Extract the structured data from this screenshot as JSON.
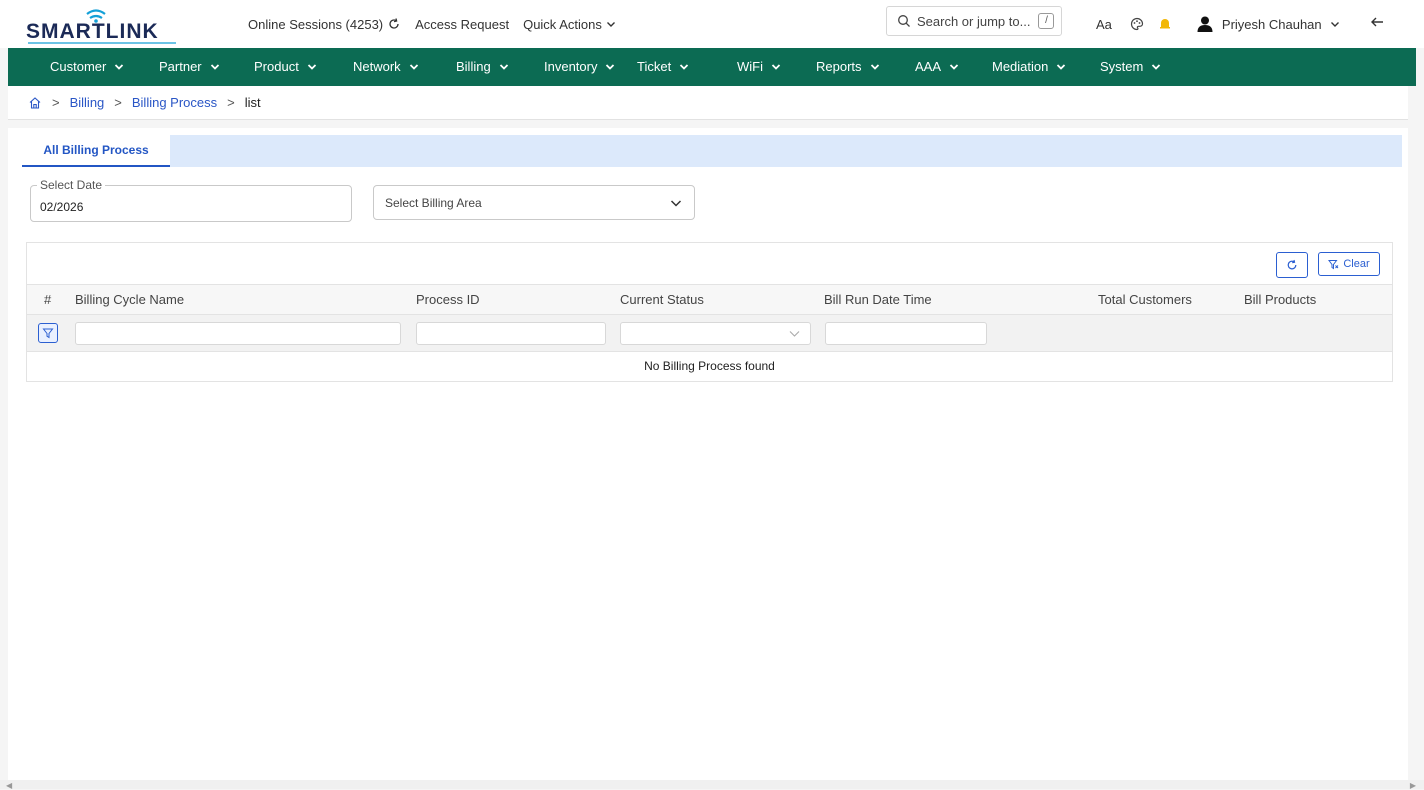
{
  "brand": {
    "logo_text": "SMARTLINK",
    "logo_color": "#1b2a57",
    "accent": "#0c6b53"
  },
  "top": {
    "online_sessions": "Online Sessions (4253)",
    "access_request": "Access Request",
    "quick_actions": "Quick Actions",
    "search_placeholder": "Search or jump to...",
    "search_shortcut": "/",
    "font_size_label": "Aa",
    "user_name": "Priyesh Chauhan",
    "icons": [
      "refresh-icon",
      "chevron-down-icon",
      "search-icon",
      "palette-icon",
      "bell-icon",
      "user-icon",
      "back-arrow-icon"
    ]
  },
  "nav": {
    "items": [
      {
        "label": "Customer"
      },
      {
        "label": "Partner"
      },
      {
        "label": "Product"
      },
      {
        "label": "Network"
      },
      {
        "label": "Billing"
      },
      {
        "label": "Inventory"
      },
      {
        "label": "Ticket"
      },
      {
        "label": "WiFi"
      },
      {
        "label": "Reports"
      },
      {
        "label": "AAA"
      },
      {
        "label": "Mediation"
      },
      {
        "label": "System"
      }
    ]
  },
  "breadcrumb": {
    "items": [
      "Billing",
      "Billing Process"
    ],
    "current": "list"
  },
  "tabs": {
    "active": "All Billing Process"
  },
  "filters": {
    "date_label": "Select Date",
    "date_value": "02/2026",
    "area_placeholder": "Select Billing Area"
  },
  "table": {
    "clear_label": "Clear",
    "columns": [
      "#",
      "Billing Cycle Name",
      "Process ID",
      "Current Status",
      "Bill Run Date Time",
      "Total Customers",
      "Bill Products"
    ],
    "empty_message": "No Billing Process found"
  }
}
